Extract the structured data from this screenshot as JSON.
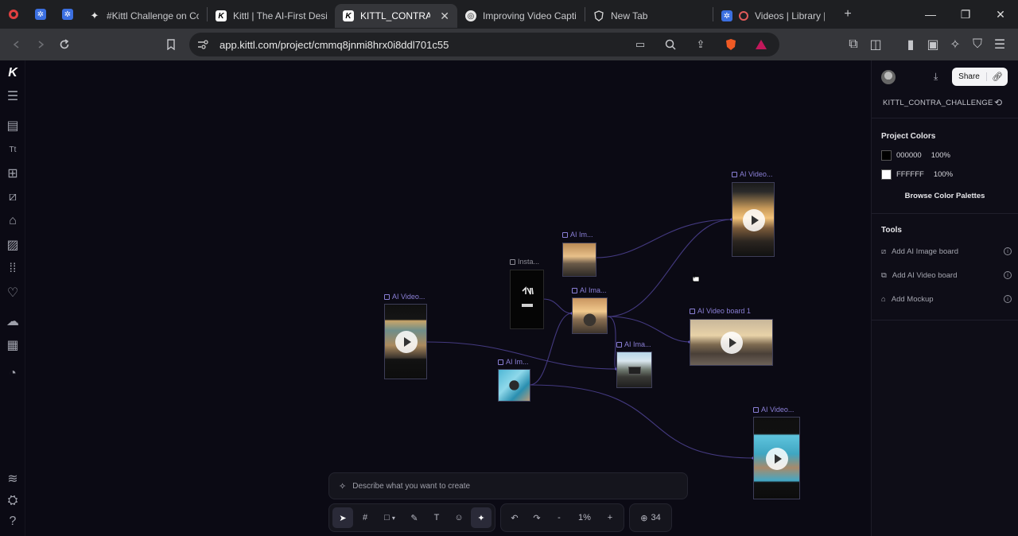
{
  "browser": {
    "tabs": [
      {
        "label": "#Kittl Challenge on Cor",
        "icon": "sparkle-icon"
      },
      {
        "label": "Kittl | The AI-First Desig",
        "icon": "kittl-icon"
      },
      {
        "label": "KITTL_CONTRA_CH",
        "icon": "kittl-icon",
        "active": true
      },
      {
        "label": "Improving Video Captio",
        "icon": "openai-icon"
      },
      {
        "label": "New Tab",
        "icon": "brave-icon"
      },
      {
        "label": "Videos | Library | Lo",
        "icon": "loom-icon"
      }
    ],
    "url": "app.kittl.com/project/cmmq8jnmi8hrx0i8ddl701c55"
  },
  "canvas": {
    "nodes": [
      {
        "label": "AI Video...",
        "color": "purple"
      },
      {
        "label": "AI Im...",
        "color": "purple"
      },
      {
        "label": "Insta...",
        "color": "gray"
      },
      {
        "label": "AI Ima...",
        "color": "purple"
      },
      {
        "label": "AI Ima...",
        "color": "purple"
      },
      {
        "label": "AI Im...",
        "color": "purple"
      },
      {
        "label": "AI Video board 1",
        "color": "purple"
      },
      {
        "label": "AI Video...",
        "color": "purple"
      },
      {
        "label": "AI Video...",
        "color": "purple"
      }
    ],
    "prompt_placeholder": "Describe what you want to create",
    "zoom_minus": "-",
    "zoom": "1%",
    "zoom_plus": "+",
    "credits": "34"
  },
  "panel": {
    "share_label": "Share",
    "project_name": "KITTL_CONTRA_CHALLENGE",
    "project_colors_title": "Project Colors",
    "colors": [
      {
        "hex": "000000",
        "opacity": "100%",
        "swatch": "#000000"
      },
      {
        "hex": "FFFFFF",
        "opacity": "100%",
        "swatch": "#ffffff"
      }
    ],
    "browse_label": "Browse Color Palettes",
    "tools_title": "Tools",
    "tools": [
      {
        "label": "Add AI Image board",
        "icon": "image-board-icon"
      },
      {
        "label": "Add AI Video board",
        "icon": "video-board-icon"
      },
      {
        "label": "Add Mockup",
        "icon": "mockup-icon"
      }
    ]
  }
}
